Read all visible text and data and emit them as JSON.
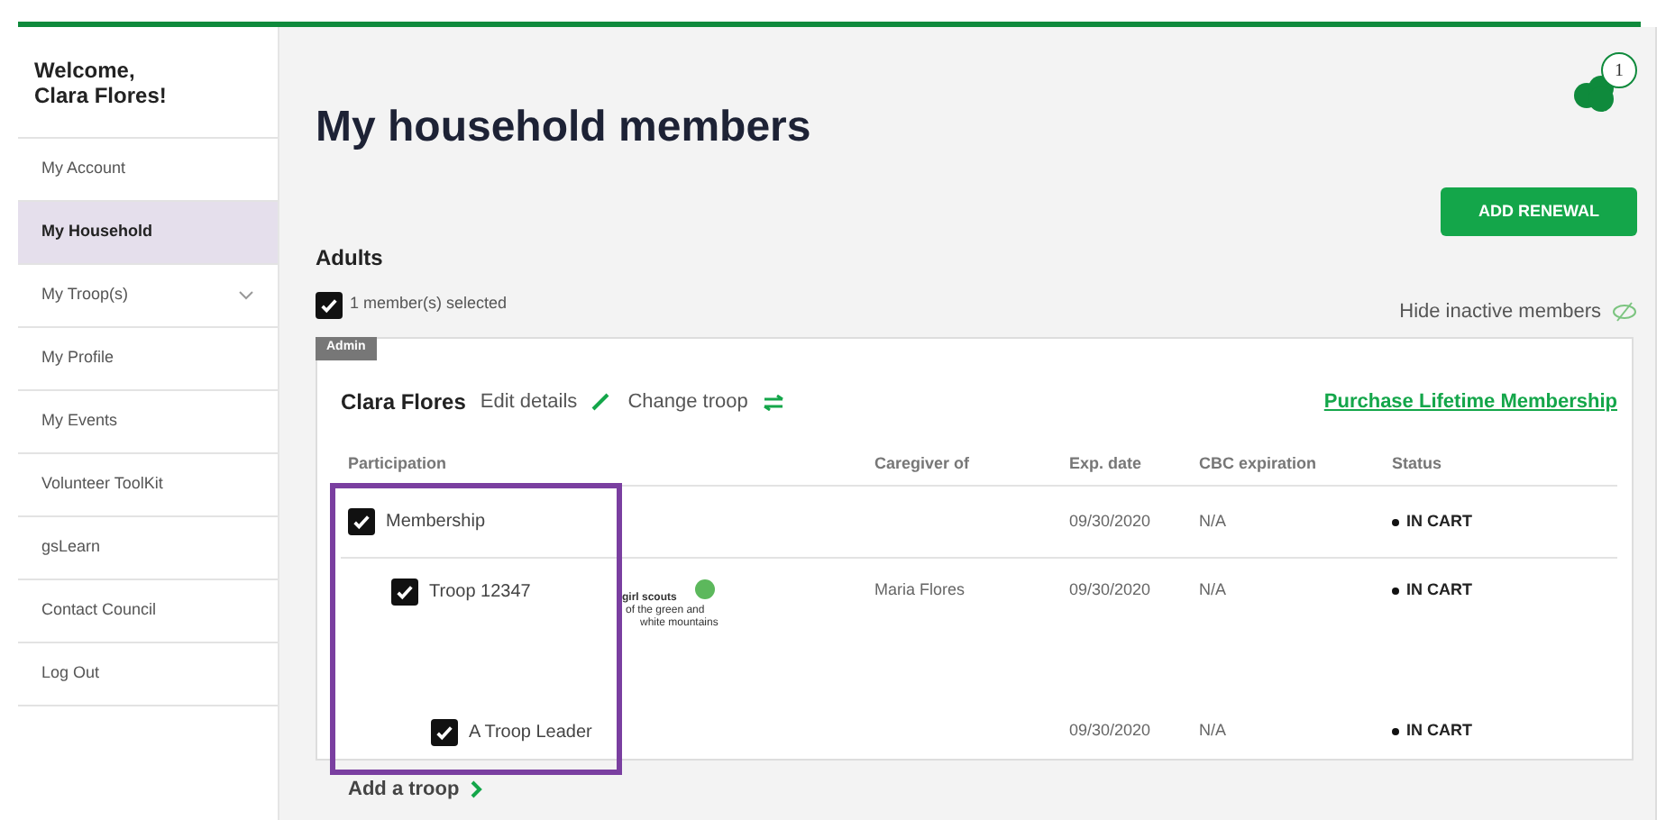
{
  "sidebar": {
    "welcome": "Welcome,\nClara Flores!",
    "items": [
      {
        "label": "My Account",
        "selected": false,
        "expandable": false
      },
      {
        "label": "My Household",
        "selected": true,
        "expandable": false
      },
      {
        "label": "My Troop(s)",
        "selected": false,
        "expandable": true
      },
      {
        "label": "My Profile",
        "selected": false,
        "expandable": false
      },
      {
        "label": "My Events",
        "selected": false,
        "expandable": false
      },
      {
        "label": "Volunteer ToolKit",
        "selected": false,
        "expandable": false
      },
      {
        "label": "gsLearn",
        "selected": false,
        "expandable": false
      },
      {
        "label": "Contact Council",
        "selected": false,
        "expandable": false
      },
      {
        "label": "Log Out",
        "selected": false,
        "expandable": false
      }
    ]
  },
  "header": {
    "title": "My household members",
    "cart_count": "1",
    "add_button": "ADD RENEWAL"
  },
  "adults": {
    "heading": "Adults",
    "select_all": {
      "label": "1 member(s) selected",
      "checked": true
    },
    "hide_inactive": "Hide inactive members"
  },
  "member": {
    "badge": "Admin",
    "name": "Clara Flores",
    "edit": "Edit details",
    "change": "Change troop",
    "lifetime_link": "Purchase Lifetime Membership",
    "columns": [
      "Participation",
      "Caregiver of",
      "Exp. date",
      "CBC expiration",
      "Status"
    ],
    "rows": [
      {
        "label": "Membership",
        "checked": true,
        "exp_date": "09/30/2020",
        "cbc": "N/A",
        "status": "IN CART",
        "children": [
          {
            "label": "Troop 12347",
            "checked": true,
            "logo": [
              "girl scouts",
              "of the green and",
              "white mountains"
            ],
            "caregiver": "Maria Flores",
            "exp_date": "09/30/2020",
            "cbc": "N/A",
            "status": "IN CART",
            "children": [
              {
                "label": "A Troop Leader",
                "checked": true,
                "exp_date": "09/30/2020",
                "cbc": "N/A",
                "status": "IN CART"
              }
            ]
          }
        ]
      }
    ]
  },
  "add_troop": "Add a troop"
}
